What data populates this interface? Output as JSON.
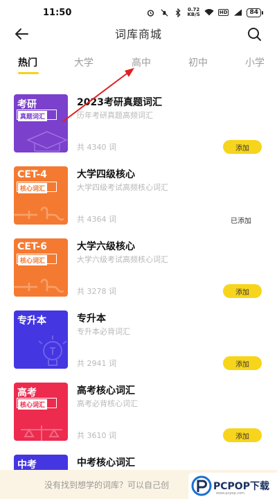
{
  "status_bar": {
    "time": "11:50",
    "net_speed_value": "0.72",
    "net_speed_unit": "KB/S",
    "hd_label": "HD",
    "battery": "84"
  },
  "nav": {
    "title": "词库商城"
  },
  "tabs": [
    {
      "label": "热门",
      "active": true
    },
    {
      "label": "大学",
      "active": false
    },
    {
      "label": "高中",
      "active": false
    },
    {
      "label": "初中",
      "active": false
    },
    {
      "label": "小学",
      "active": false
    }
  ],
  "items": [
    {
      "cover_title": "考研",
      "cover_tag": "真题词汇",
      "cover_color": "#7b40cc",
      "cover_tag_color": "#7b40cc",
      "cover_icon": "graduation-cap-icon",
      "title": "2023考研真题词汇",
      "desc": "历年考研真题高频词汇",
      "count": "共 4340 词",
      "action": "添加",
      "added": false
    },
    {
      "cover_title": "CET-4",
      "cover_tag": "核心词汇",
      "cover_color": "#f47a32",
      "cover_tag_color": "#f47a32",
      "cover_icon": "key-icon",
      "title": "大学四级核心",
      "desc": "大学四级考试高频核心词汇",
      "count": "共 4364 词",
      "action": "已添加",
      "added": true
    },
    {
      "cover_title": "CET-6",
      "cover_tag": "核心词汇",
      "cover_color": "#f47a32",
      "cover_tag_color": "#f47a32",
      "cover_icon": "key-icon",
      "title": "大学六级核心",
      "desc": "大学六级考试高频核心词汇",
      "count": "共 3278 词",
      "action": "添加",
      "added": false
    },
    {
      "cover_title": "专升本",
      "cover_tag": "",
      "cover_color": "#4436e0",
      "cover_tag_color": "#4436e0",
      "cover_icon": "lightbulb-icon",
      "title": "专升本",
      "desc": "专升本必背词汇",
      "count": "共 2941 词",
      "action": "添加",
      "added": false
    },
    {
      "cover_title": "高考",
      "cover_tag": "核心词汇",
      "cover_color": "#ec2b4f",
      "cover_tag_color": "#ec2b4f",
      "cover_icon": "scale-icon",
      "title": "高考核心词汇",
      "desc": "高考必背核心词汇",
      "count": "共 3610 词",
      "action": "添加",
      "added": false
    },
    {
      "cover_title": "中考",
      "cover_tag": "",
      "cover_color": "#4436e0",
      "cover_tag_color": "#4436e0",
      "cover_icon": "",
      "title": "中考核心词汇",
      "desc": "",
      "count": "",
      "action": "",
      "added": false
    }
  ],
  "bottom_bar": {
    "text": "没有找到想学的词库？可以自己创"
  },
  "watermark": {
    "text": "PCPOP下载",
    "sub": "www.pcpop.com"
  },
  "colors": {
    "accent": "#f8d51d",
    "annotation": "#e02020"
  }
}
